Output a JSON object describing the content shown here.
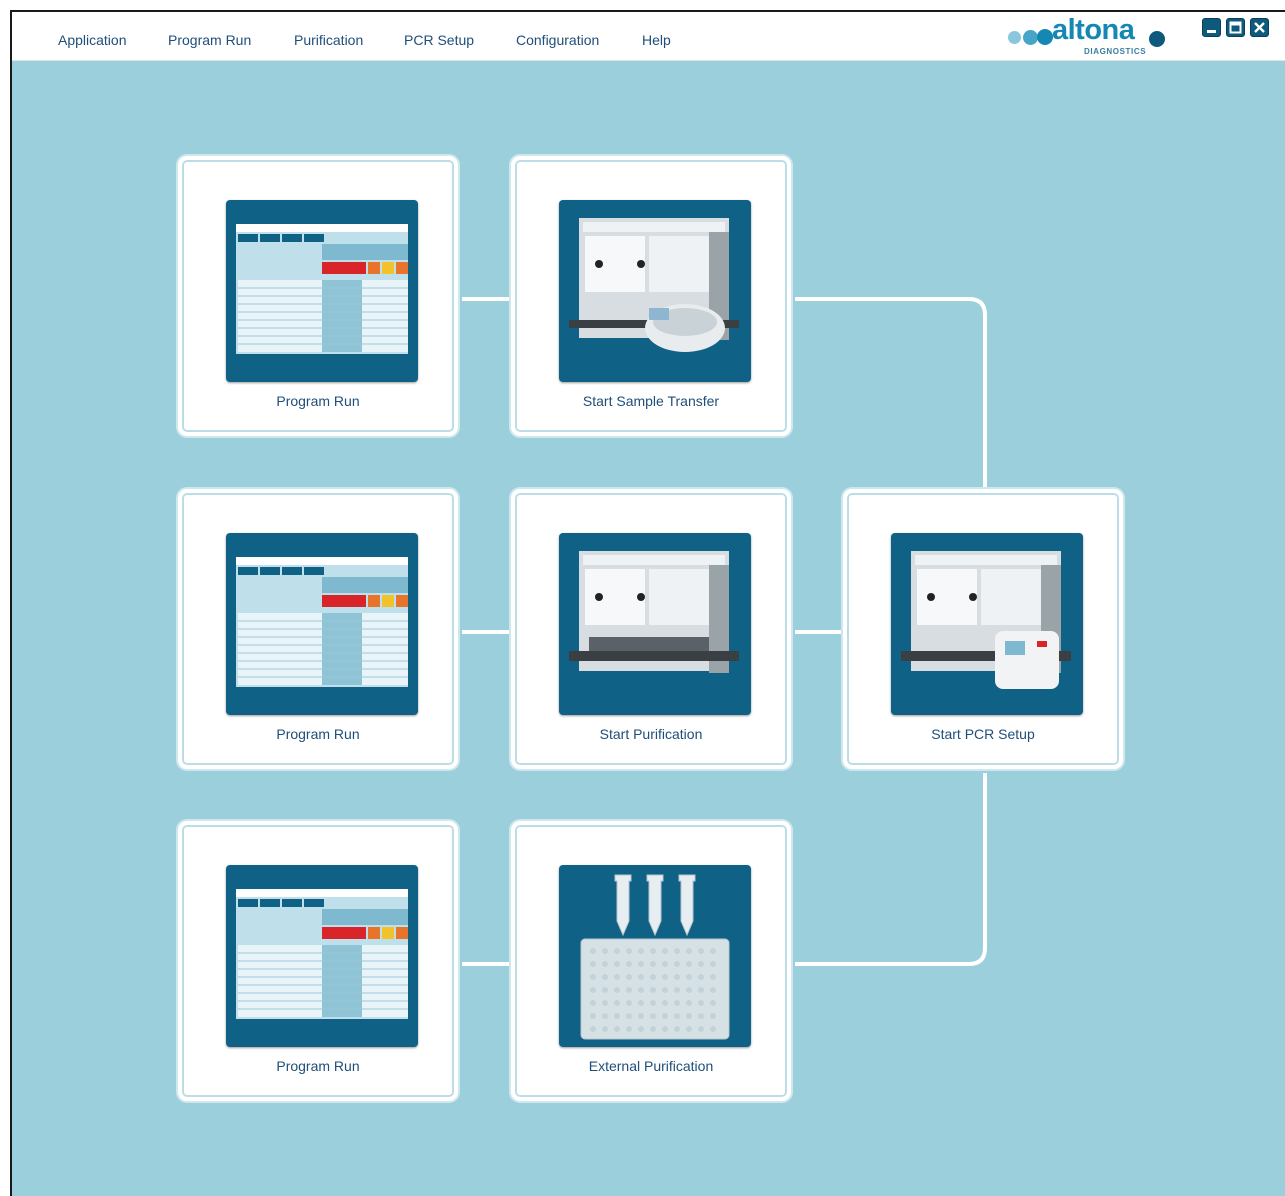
{
  "menu": {
    "items": [
      "Application",
      "Program Run",
      "Purification",
      "PCR Setup",
      "Configuration",
      "Help"
    ]
  },
  "brand": {
    "name": "altona",
    "sub": "DIAGNOSTICS",
    "color": "#1587b3"
  },
  "window_controls": [
    "minimize-icon",
    "maximize-icon",
    "close-icon"
  ],
  "colors": {
    "background": "#9ccfdc",
    "tile_bg": "#ffffff",
    "thumbnail_bg": "#0f6186",
    "label": "#1f4e79",
    "connector": "#ffffff"
  },
  "tiles": [
    {
      "label": "Program Run",
      "image": "program-run-screenshot"
    },
    {
      "label": "Start Sample Transfer",
      "image": "liquid-handler-with-centrifuge"
    },
    {
      "label": "Program Run",
      "image": "program-run-screenshot"
    },
    {
      "label": "Start Purification",
      "image": "liquid-handler"
    },
    {
      "label": "Start PCR Setup",
      "image": "liquid-handler-with-thermocycler"
    },
    {
      "label": "Program Run",
      "image": "program-run-screenshot"
    },
    {
      "label": "External Purification",
      "image": "tubes-and-plate"
    }
  ]
}
